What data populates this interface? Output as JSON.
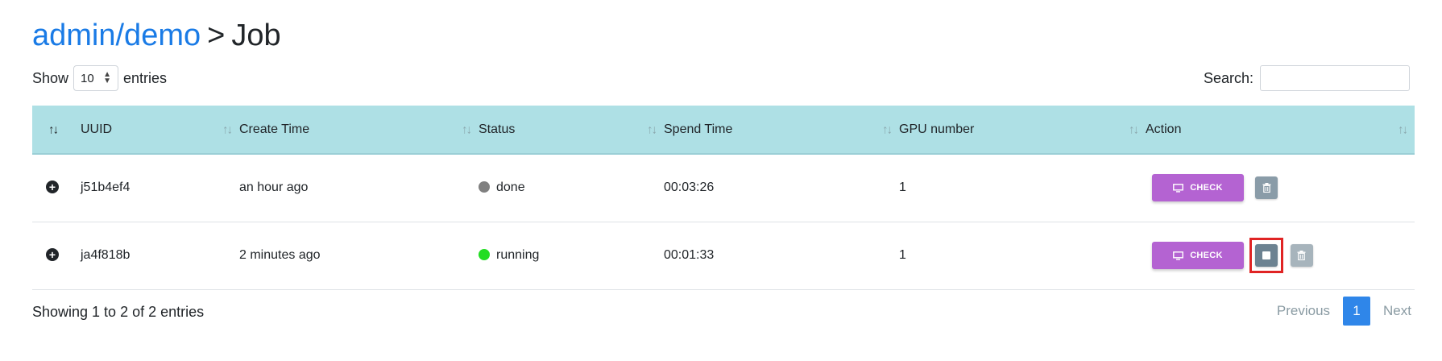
{
  "header": {
    "breadcrumb_link": "admin/demo",
    "separator": ">",
    "current": "Job"
  },
  "controls": {
    "show_label": "Show",
    "entries_value": "10",
    "entries_label": "entries",
    "search_label": "Search:",
    "search_value": ""
  },
  "table": {
    "columns": [
      "UUID",
      "Create Time",
      "Status",
      "Spend Time",
      "GPU number",
      "Action"
    ],
    "rows": [
      {
        "uuid": "j51b4ef4",
        "create_time": "an hour ago",
        "status": "done",
        "status_color": "#808080",
        "spend_time": "00:03:26",
        "gpu": "1"
      },
      {
        "uuid": "ja4f818b",
        "create_time": "2 minutes ago",
        "status": "running",
        "status_color": "#22dd22",
        "spend_time": "00:01:33",
        "gpu": "1"
      }
    ],
    "check_label": "CHECK"
  },
  "footer": {
    "info": "Showing 1 to 2 of 2 entries",
    "prev": "Previous",
    "page": "1",
    "next": "Next"
  },
  "colors": {
    "link": "#1a7be6",
    "header_bg": "#aee0e5",
    "check_button": "#b463d2",
    "highlight_border": "#e02424",
    "active_page": "#2f86e9"
  },
  "icons": [
    "plus-circle-icon",
    "sort-icon",
    "monitor-icon",
    "trash-icon",
    "stop-icon",
    "select-arrows-icon"
  ]
}
